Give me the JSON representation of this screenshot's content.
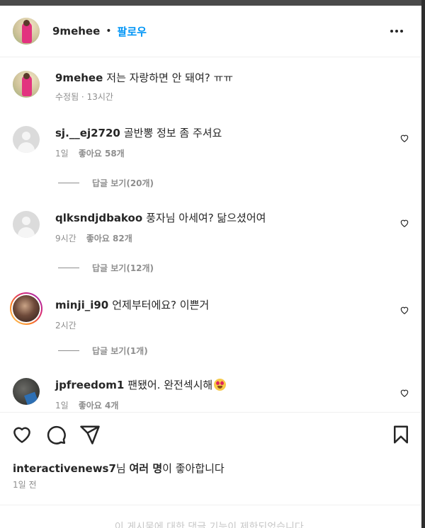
{
  "post_author": {
    "username": "9mehee",
    "follow_label": "팔로우"
  },
  "caption": {
    "username": "9mehee",
    "text": "저는 자랑하면 안 돼여? ㅠㅠ",
    "meta": "수정됨 · 13시간"
  },
  "comments": [
    {
      "username": "sj.__ej2720",
      "text": "골반뽕 정보 좀 주셔요",
      "time": "1일",
      "likes": "좋아요 58개",
      "replies": "답글 보기(20개)",
      "avatar": "default-avatar"
    },
    {
      "username": "qlksndjdbakoo",
      "text": "풍자님 아세여? 닮으셨어여",
      "time": "9시간",
      "likes": "좋아요 82개",
      "replies": "답글 보기(12개)",
      "avatar": "default-avatar"
    },
    {
      "username": "minji_i90",
      "text": "언제부터에요? 이쁜거",
      "time": "2시간",
      "likes": "",
      "replies": "답글 보기(1개)",
      "avatar": "story-ring-avatar"
    },
    {
      "username": "jpfreedom1",
      "text": "팬됐어. 완전섹시해",
      "time": "1일",
      "likes": "좋아요 4개",
      "replies": "",
      "avatar": "photo-avatar",
      "emoji": "heart-eyes-emoji"
    }
  ],
  "likes_summary": {
    "user": "interactivenews7",
    "mid": "님 ",
    "bold": "여러 명",
    "suffix": "이 좋아합니다"
  },
  "post_time": "1일 전",
  "comments_disabled": "이 게시물에 대한 댓글 기능이 제한되었습니다.",
  "icons": [
    "more-icon",
    "heart-icon",
    "comment-icon",
    "share-icon",
    "save-icon"
  ]
}
